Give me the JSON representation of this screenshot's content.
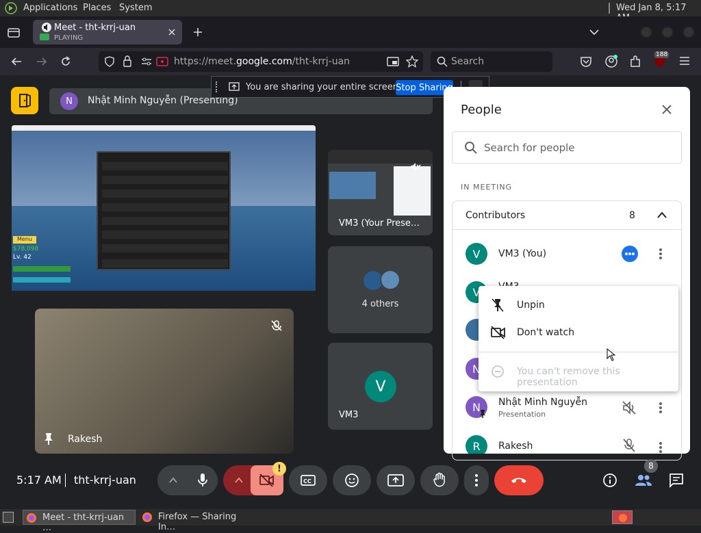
{
  "system_bar": {
    "menus": [
      "Applications",
      "Places",
      "System"
    ],
    "clock": "Wed Jan  8,  5:17 AM"
  },
  "browser": {
    "tab": {
      "title": "Meet - tht-krrj-uan",
      "status": "PLAYING"
    },
    "url_prefix": "https://meet.",
    "url_domain": "google.com",
    "url_path": "/tht-krrj-uan",
    "search_placeholder": "Search",
    "extension_badge": "188"
  },
  "share_banner": {
    "text": "You are sharing your entire screen.",
    "stop_label": "Stop Sharing"
  },
  "meet": {
    "presenter_initial": "N",
    "presenter_label": "Nhật Minh Nguyễn (Presenting)",
    "presentation_game_hud": {
      "menu": "Menu",
      "money": "$78,098",
      "level": "Lv. 42"
    },
    "thumb_label": "VM3 (Your Prese…",
    "others_label": "4 others",
    "vm3_tile_initial": "V",
    "vm3_tile_name": "VM3",
    "camera_tile_name": "Rakesh",
    "time": "5:17 AM",
    "meeting_code": "tht-krrj-uan",
    "participants_count": "8",
    "camera_alert": "!"
  },
  "people_panel": {
    "title": "People",
    "search_placeholder": "Search for people",
    "section_label": "IN MEETING",
    "group_label": "Contributors",
    "group_count": "8",
    "rows": [
      {
        "initial": "V",
        "name": "VM3 (You)",
        "sub": "",
        "color": "#00897b"
      },
      {
        "initial": "V",
        "name": "VM3",
        "sub": "",
        "color": "#00897b"
      },
      {
        "initial": "N",
        "name": "Nhật Minh Nguyễn",
        "sub": "",
        "color": "#7e57c2"
      },
      {
        "initial": "N",
        "name": "Nhật Minh Nguyễn",
        "sub": "Presentation",
        "color": "#7e57c2"
      },
      {
        "initial": "R",
        "name": "Rakesh",
        "sub": "",
        "color": "#00897b"
      }
    ]
  },
  "context_menu": {
    "items": [
      "Unpin",
      "Don't watch",
      "You can't remove this presentation"
    ]
  },
  "taskbar": {
    "items": [
      "Meet - tht-krrj-uan …",
      "Firefox — Sharing In…"
    ]
  },
  "colors": {
    "accent": "#1a73e8",
    "end_call": "#ea4335",
    "camera_off": "#8c2326",
    "meet_bg": "#202124",
    "tile": "#3c4043",
    "firefox_blue": "#0060df"
  }
}
